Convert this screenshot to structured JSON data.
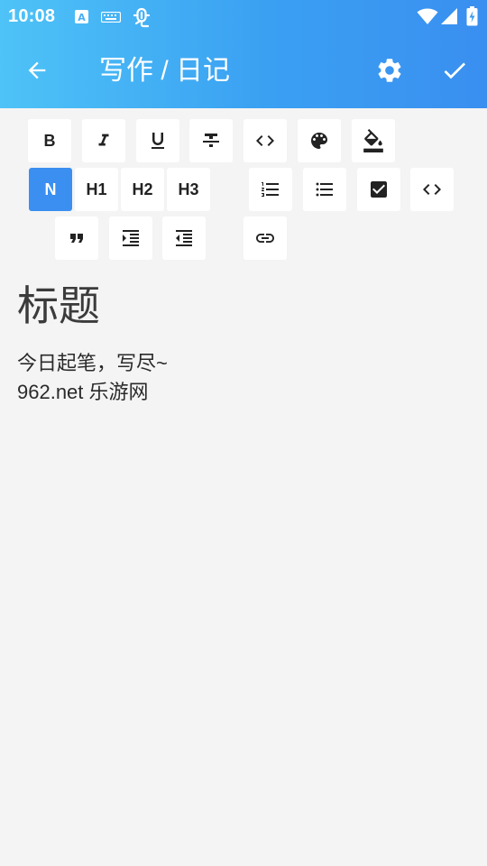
{
  "status_bar": {
    "time": "10:08",
    "icons": [
      "notification-a-icon",
      "keyboard-icon",
      "bug-icon",
      "wifi-icon",
      "signal-icon",
      "battery-charging-icon"
    ]
  },
  "app_bar": {
    "title": "写作 / 日记",
    "back_icon": "arrow-left-icon",
    "settings_icon": "gear-icon",
    "confirm_icon": "check-icon"
  },
  "editor_toolbar": {
    "bold_label": "B",
    "normal_label": "N",
    "h1_label": "H1",
    "h2_label": "H2",
    "h3_label": "H3",
    "active_style": "N"
  },
  "document": {
    "heading": "标题",
    "lines": [
      "今日起笔，写尽~",
      "962.net 乐游网"
    ]
  },
  "colors": {
    "appbar_start": "#4ec3f7",
    "appbar_end": "#3a8ff0",
    "active_button": "#3a8ff0",
    "background": "#f4f4f4"
  }
}
